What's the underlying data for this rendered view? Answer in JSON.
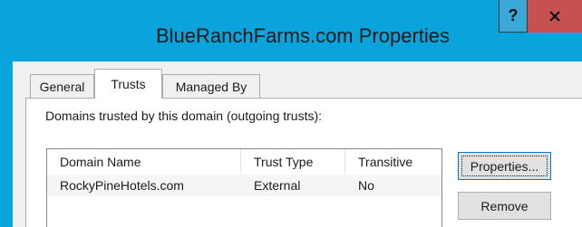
{
  "window": {
    "title": "BlueRanchFarms.com Properties",
    "help_label": "?",
    "close_icon": "close-icon"
  },
  "tabs": [
    {
      "label": "General",
      "active": false
    },
    {
      "label": "Trusts",
      "active": true
    },
    {
      "label": "Managed By",
      "active": false
    }
  ],
  "trusts": {
    "outgoing_label": "Domains trusted by this domain (outgoing trusts):",
    "columns": [
      "Domain Name",
      "Trust Type",
      "Transitive"
    ],
    "rows": [
      {
        "domain": "RockyPineHotels.com",
        "type": "External",
        "transitive": "No"
      }
    ],
    "properties_button": "Properties...",
    "remove_button": "Remove"
  },
  "colors": {
    "titlebar": "#0aa3dc",
    "close_button": "#c75050",
    "dialog_background": "#f0f0f0",
    "selected_row": "#f5f5f5"
  }
}
